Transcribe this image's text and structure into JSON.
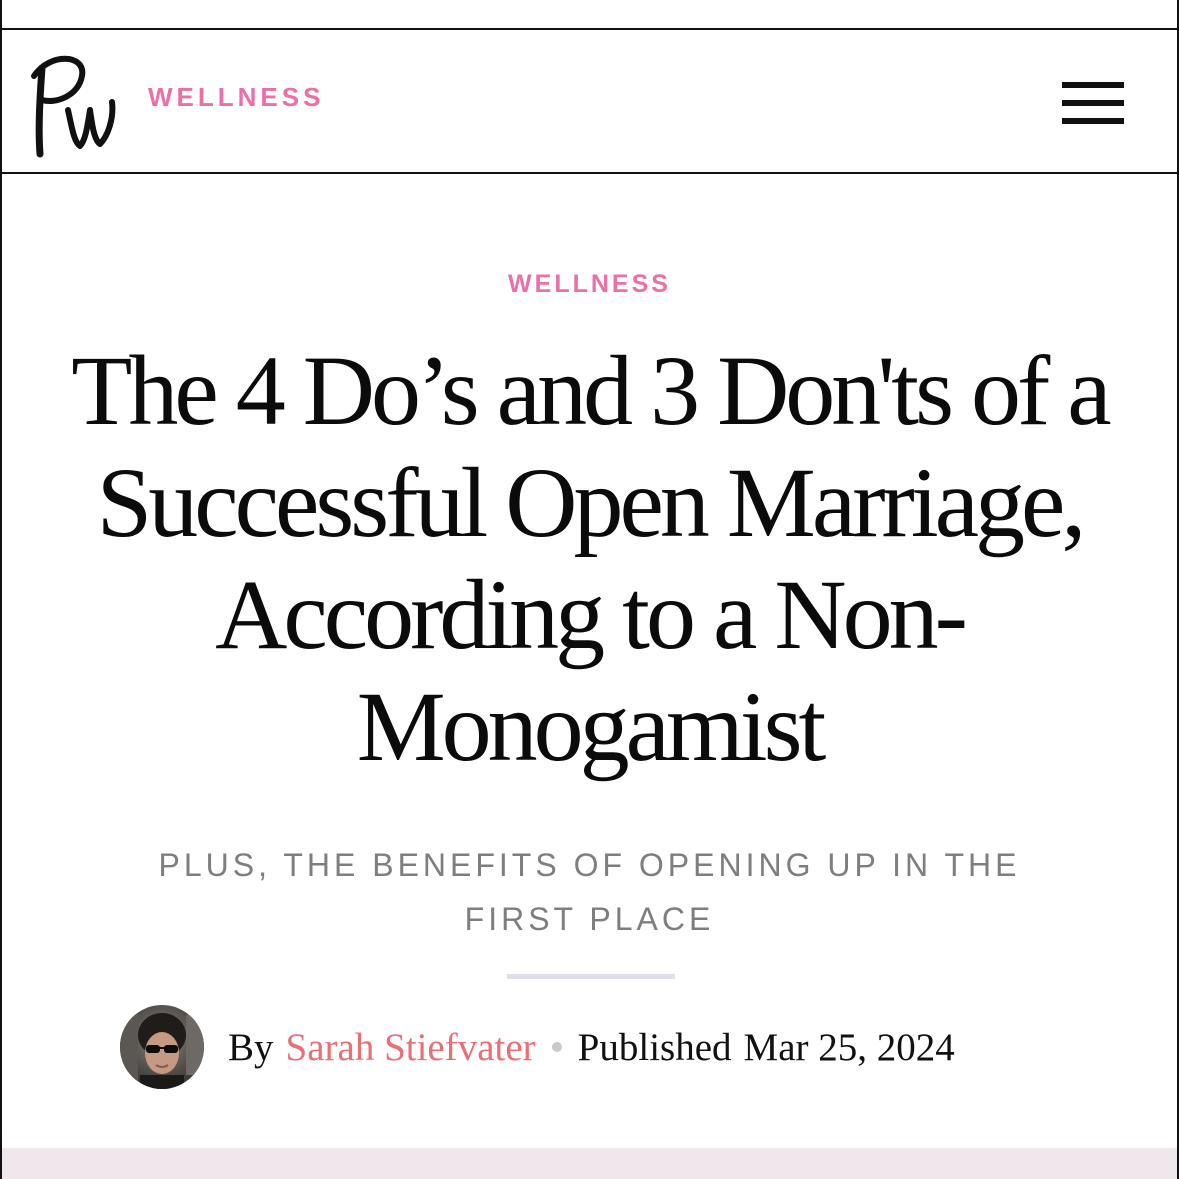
{
  "header": {
    "logo_icon": "pw-script-logo",
    "section_label": "WELLNESS",
    "menu_icon": "hamburger-menu-icon"
  },
  "article": {
    "category": "WELLNESS",
    "headline": "The 4 Do’s and 3 Don'ts of a Successful Open Marriage, According to a Non-Monogamist",
    "dek": "Plus, the Benefits of Opening Up in the First Place",
    "byline": {
      "by_label": "By",
      "author": "Sarah Stiefvater",
      "published_label": "Published",
      "date": "Mar 25, 2024"
    }
  },
  "colors": {
    "accent_pink": "#ec6fa8",
    "author_link": "#e86f74",
    "dek_gray": "#7e7e7e",
    "divider": "#e0deea",
    "bottom_strip": "#efe7ec"
  }
}
